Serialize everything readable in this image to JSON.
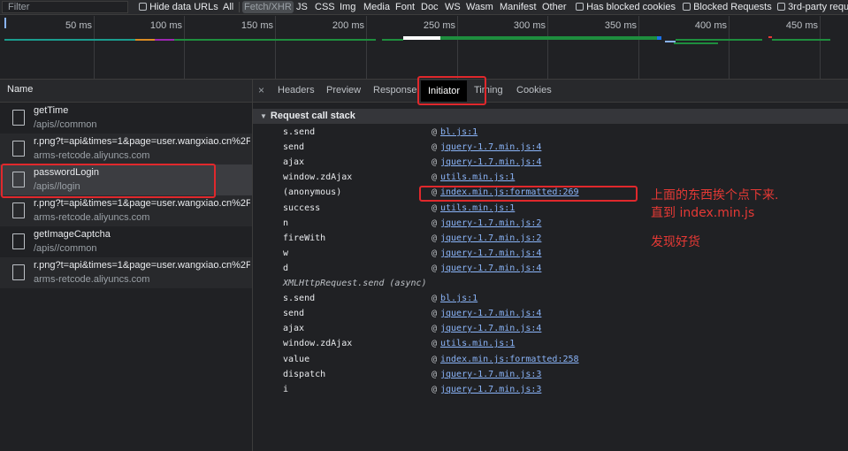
{
  "filter_bar": {
    "placeholder": "Filter",
    "hide_data_urls": "Hide data URLs",
    "types": [
      "All",
      "Fetch/XHR",
      "JS",
      "CSS",
      "Img",
      "Media",
      "Font",
      "Doc",
      "WS",
      "Wasm",
      "Manifest",
      "Other"
    ],
    "active_type": "Fetch/XHR",
    "has_blocked_cookies": "Has blocked cookies",
    "blocked_requests": "Blocked Requests",
    "third_party": "3rd-party requ"
  },
  "overview": {
    "ticks": [
      "50 ms",
      "100 ms",
      "150 ms",
      "200 ms",
      "250 ms",
      "300 ms",
      "350 ms",
      "400 ms",
      "450 ms"
    ]
  },
  "requests": {
    "header": "Name",
    "rows": [
      {
        "title": "getTime",
        "sub": "/apis//common"
      },
      {
        "title": "r.png?t=api&times=1&page=user.wangxiao.cn%2F...",
        "sub": "arms-retcode.aliyuncs.com"
      },
      {
        "title": "passwordLogin",
        "sub": "/apis//login"
      },
      {
        "title": "r.png?t=api&times=1&page=user.wangxiao.cn%2F...",
        "sub": "arms-retcode.aliyuncs.com"
      },
      {
        "title": "getImageCaptcha",
        "sub": "/apis//common"
      },
      {
        "title": "r.png?t=api&times=1&page=user.wangxiao.cn%2F...",
        "sub": "arms-retcode.aliyuncs.com"
      }
    ]
  },
  "detail": {
    "close": "×",
    "tabs": [
      "Headers",
      "Preview",
      "Response",
      "Initiator",
      "Timing",
      "Cookies"
    ],
    "active_tab": "Initiator",
    "section_title": "Request call stack",
    "stack": [
      {
        "fn": "s.send",
        "link": "bl.js:1"
      },
      {
        "fn": "send",
        "link": "jquery-1.7.min.js:4"
      },
      {
        "fn": "ajax",
        "link": "jquery-1.7.min.js:4"
      },
      {
        "fn": "window.zdAjax",
        "link": "utils.min.js:1"
      },
      {
        "fn": "(anonymous)",
        "link": "index.min.js:formatted:269"
      },
      {
        "fn": "success",
        "link": "utils.min.js:1"
      },
      {
        "fn": "n",
        "link": "jquery-1.7.min.js:2"
      },
      {
        "fn": "fireWith",
        "link": "jquery-1.7.min.js:2"
      },
      {
        "fn": "w",
        "link": "jquery-1.7.min.js:4"
      },
      {
        "fn": "d",
        "link": "jquery-1.7.min.js:4"
      },
      {
        "fn": "XMLHttpRequest.send (async)",
        "async": true
      },
      {
        "fn": "s.send",
        "link": "bl.js:1"
      },
      {
        "fn": "send",
        "link": "jquery-1.7.min.js:4"
      },
      {
        "fn": "ajax",
        "link": "jquery-1.7.min.js:4"
      },
      {
        "fn": "window.zdAjax",
        "link": "utils.min.js:1"
      },
      {
        "fn": "value",
        "link": "index.min.js:formatted:258"
      },
      {
        "fn": "dispatch",
        "link": "jquery-1.7.min.js:3"
      },
      {
        "fn": "i",
        "link": "jquery-1.7.min.js:3"
      }
    ],
    "at": "@"
  },
  "annotation": {
    "line1": "上面的东西挨个点下来.",
    "line2": "直到  index.min.js",
    "line3": "发现好货",
    "color": "#e53935"
  }
}
